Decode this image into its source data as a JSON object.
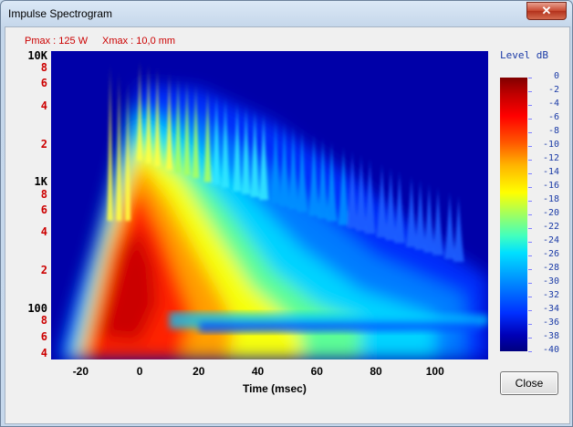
{
  "window": {
    "title": "Impulse Spectrogram",
    "close_glyph": "✕"
  },
  "info": {
    "pmax": "Pmax : 125 W",
    "xmax": "Xmax : 10,0 mm"
  },
  "y_axis": {
    "ticks": [
      {
        "label": "10K",
        "kind": "major"
      },
      {
        "label": "8",
        "kind": "minor"
      },
      {
        "label": "6",
        "kind": "minor"
      },
      {
        "label": "4",
        "kind": "minor"
      },
      {
        "label": "2",
        "kind": "minor"
      },
      {
        "label": "1K",
        "kind": "major"
      },
      {
        "label": "8",
        "kind": "minor"
      },
      {
        "label": "6",
        "kind": "minor"
      },
      {
        "label": "4",
        "kind": "minor"
      },
      {
        "label": "2",
        "kind": "minor"
      },
      {
        "label": "100",
        "kind": "major"
      },
      {
        "label": "8",
        "kind": "minor"
      },
      {
        "label": "6",
        "kind": "minor"
      },
      {
        "label": "4",
        "kind": "minor"
      }
    ]
  },
  "x_axis": {
    "ticks": [
      "-20",
      "0",
      "20",
      "40",
      "60",
      "80",
      "100"
    ],
    "title": "Time (msec)"
  },
  "legend": {
    "title": "Level  dB",
    "labels": [
      "0",
      "-2",
      "-4",
      "-6",
      "-8",
      "-10",
      "-12",
      "-14",
      "-16",
      "-18",
      "-20",
      "-22",
      "-24",
      "-26",
      "-28",
      "-30",
      "-32",
      "-34",
      "-36",
      "-38",
      "-40"
    ]
  },
  "buttons": {
    "close": "Close"
  },
  "chart_data": {
    "type": "heatmap",
    "xlabel": "Time (msec)",
    "ylabel": "",
    "xlim": [
      -30,
      118
    ],
    "ylim": [
      40,
      11000
    ],
    "y_scale": "log",
    "x_ticks": [
      -20,
      0,
      20,
      40,
      60,
      80,
      100
    ],
    "y_ticks": [
      10000,
      8000,
      6000,
      4000,
      2000,
      1000,
      800,
      600,
      400,
      200,
      100,
      80,
      60,
      40
    ],
    "colorbar": {
      "label": "Level  dB",
      "min": -40,
      "max": 0,
      "step": 2
    },
    "colors": {
      "high": "#800000",
      "low": "#00007f",
      "background": "#0000a8"
    },
    "features": {
      "main_peak_time_ms": 0,
      "comb_peak_times_ms": [
        -10,
        -7,
        -4,
        0,
        3,
        6,
        10,
        13,
        16,
        19,
        23,
        26,
        29,
        33,
        36,
        39,
        42,
        46,
        49,
        52,
        55,
        59,
        62,
        65,
        69,
        72,
        75,
        78,
        82,
        85,
        88,
        92,
        95,
        98,
        101,
        105,
        108
      ]
    }
  }
}
